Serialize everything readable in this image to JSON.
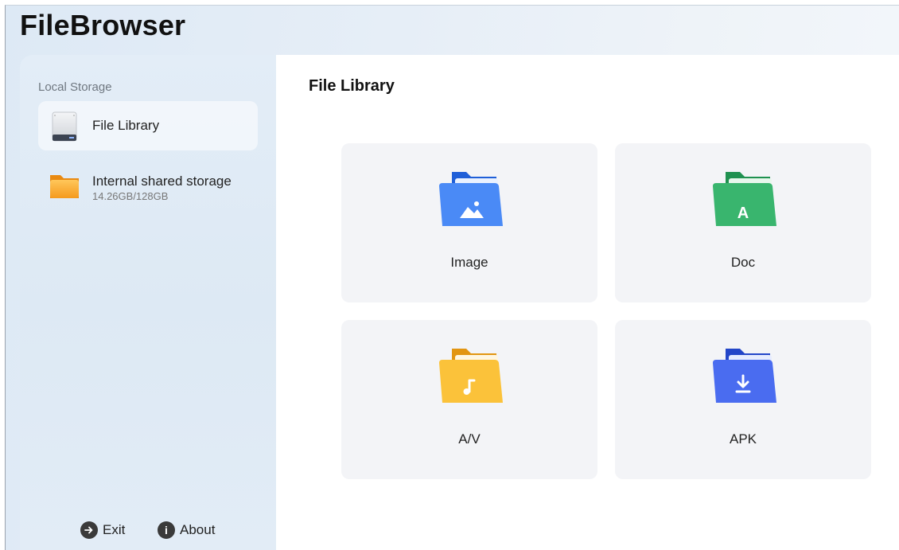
{
  "app": {
    "title": "FileBrowser"
  },
  "sidebar": {
    "section_label": "Local Storage",
    "items": [
      {
        "label": "File Library",
        "icon": "drive-icon",
        "active": true
      },
      {
        "label": "Internal shared storage",
        "sub": "14.26GB/128GB",
        "icon": "folder-icon"
      }
    ],
    "footer": {
      "exit_label": "Exit",
      "about_label": "About",
      "about_glyph": "i"
    }
  },
  "main": {
    "title": "File Library",
    "categories": [
      {
        "label": "Image",
        "icon": "image-folder-icon",
        "color": "#3b7cf0"
      },
      {
        "label": "Doc",
        "icon": "doc-folder-icon",
        "color": "#2faa62"
      },
      {
        "label": "A/V",
        "icon": "audio-folder-icon",
        "color": "#f6b82a"
      },
      {
        "label": "APK",
        "icon": "apk-folder-icon",
        "color": "#3d62e6"
      }
    ]
  }
}
